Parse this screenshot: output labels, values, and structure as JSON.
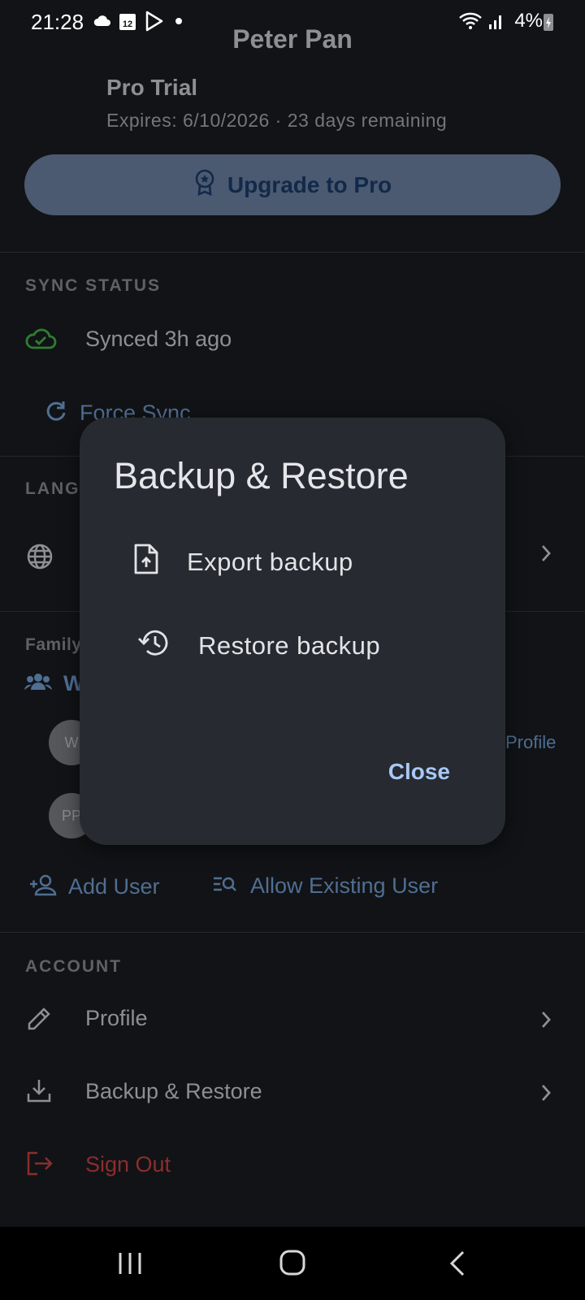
{
  "status_bar": {
    "time": "21:28",
    "battery": "4%"
  },
  "profile": {
    "name": "Peter Pan"
  },
  "trial": {
    "title": "Pro Trial",
    "expires": "Expires: 6/10/2026 · 23 days remaining"
  },
  "upgrade": {
    "label": "Upgrade to Pro"
  },
  "sync": {
    "section": "SYNC STATUS",
    "status": "Synced 3h ago",
    "force_label": "Force Sync"
  },
  "language": {
    "section": "LANG"
  },
  "family": {
    "section": "Family",
    "group": "W",
    "avatars": [
      "W",
      "PP"
    ],
    "profile_link": "Profile"
  },
  "users": {
    "add": "Add User",
    "allow_existing": "Allow Existing User"
  },
  "account": {
    "section": "ACCOUNT",
    "profile": "Profile",
    "backup": "Backup & Restore",
    "sign_out": "Sign Out"
  },
  "dialog": {
    "title": "Backup & Restore",
    "export": "Export backup",
    "restore": "Restore backup",
    "close": "Close"
  },
  "colors": {
    "accent": "#a8c8f5",
    "danger": "#8a2e2c",
    "success": "#2e7d32"
  }
}
